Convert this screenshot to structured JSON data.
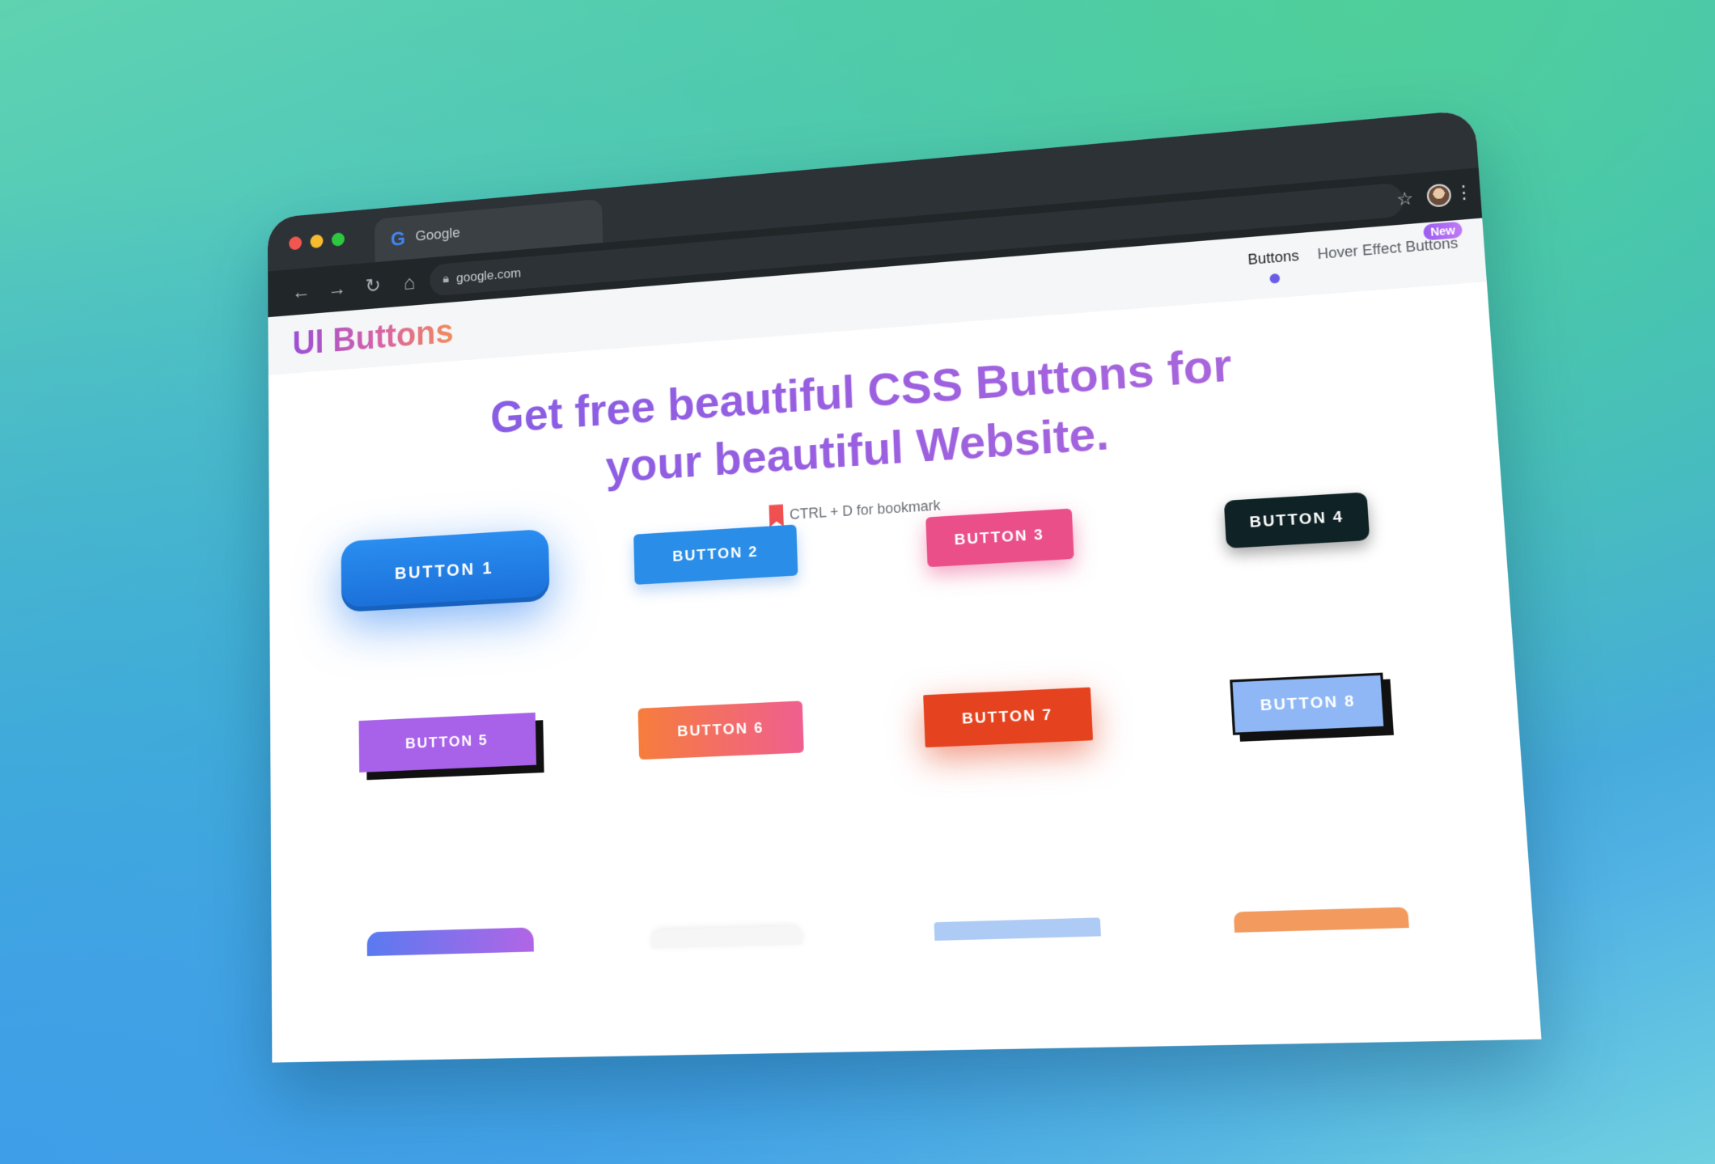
{
  "browser": {
    "tab_title": "Google",
    "url": "google.com"
  },
  "site": {
    "logo": "UI Buttons",
    "nav": [
      {
        "label": "Buttons",
        "active": true
      },
      {
        "label": "Hover Effect Buttons",
        "badge": "New"
      }
    ]
  },
  "hero": {
    "title_line1": "Get free beautiful CSS Buttons for",
    "title_line2": "your beautiful Website.",
    "hint": "CTRL + D for bookmark"
  },
  "buttons": [
    {
      "label": "BUTTON 1",
      "color": "#1a6fd8"
    },
    {
      "label": "BUTTON 2",
      "color": "#2a8de8"
    },
    {
      "label": "BUTTON 3",
      "color": "#ea4f8a"
    },
    {
      "label": "BUTTON 4",
      "color": "#0f2226"
    },
    {
      "label": "BUTTON 5",
      "color": "#a862ea"
    },
    {
      "label": "BUTTON 6",
      "color": "#f67d3c"
    },
    {
      "label": "BUTTON 7",
      "color": "#e5431f"
    },
    {
      "label": "BUTTON 8",
      "color": "#8fb7f5"
    }
  ],
  "icons": {
    "back": "arrow-left-icon",
    "forward": "arrow-right-icon",
    "reload": "reload-icon",
    "home": "home-icon",
    "lock": "lock-icon",
    "star": "star-icon",
    "menu": "kebab-icon",
    "bookmark": "bookmark-icon"
  }
}
